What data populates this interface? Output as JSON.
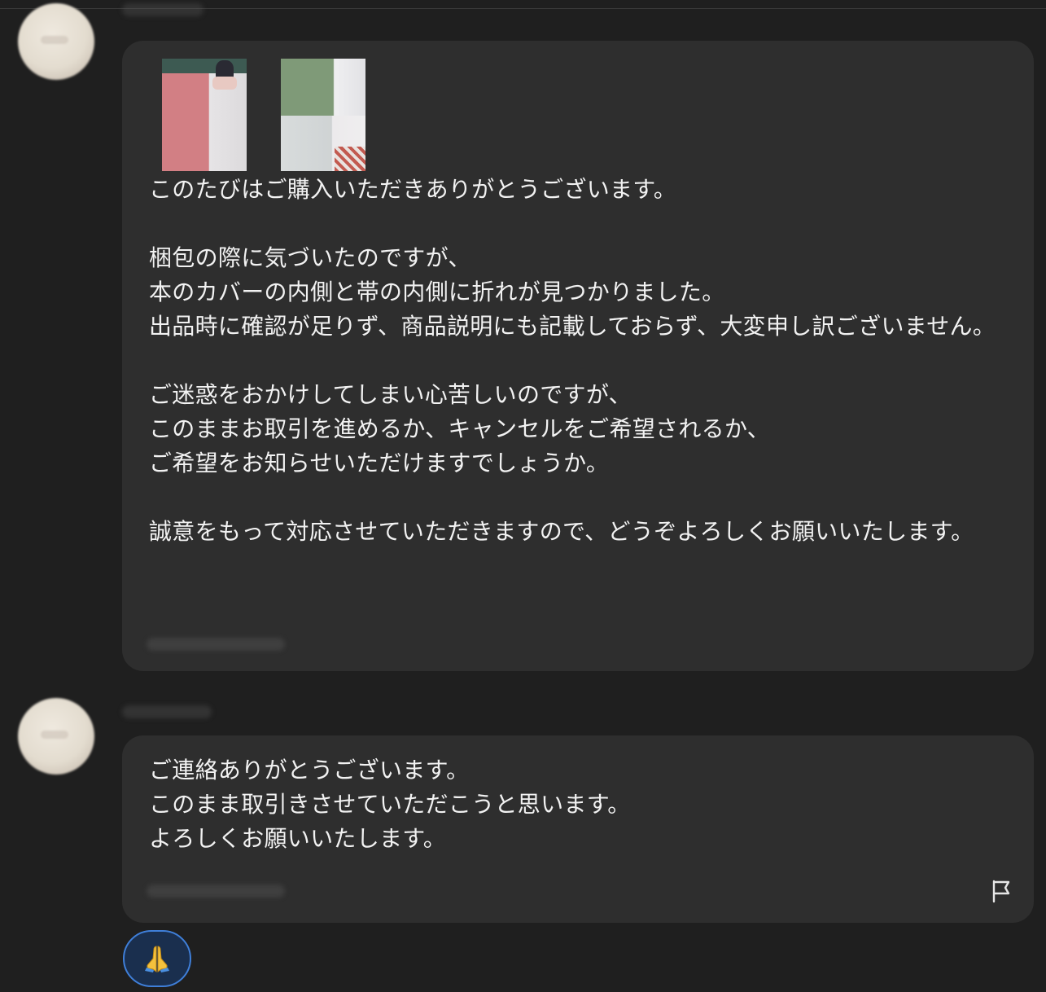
{
  "messages": [
    {
      "sender": "seller",
      "attachments": [
        {
          "icon": "book-cover-photo"
        },
        {
          "icon": "book-inner-photo"
        }
      ],
      "text": "このたびはご購入いただきありがとうございます。\n\n梱包の際に気づいたのですが、\n本のカバーの内側と帯の内側に折れが見つかりました。\n出品時に確認が足りず、商品説明にも記載しておらず、大変申し訳ございません。\n\nご迷惑をおかけしてしまい心苦しいのですが、\nこのままお取引を進めるか、キャンセルをご希望されるか、\nご希望をお知らせいただけますでしょうか。\n\n誠意をもって対応させていただきますので、どうぞよろしくお願いいたします。"
    },
    {
      "sender": "buyer",
      "text": "ご連絡ありがとうございます。\nこのまま取引きさせていただこうと思います。\nよろしくお願いいたします。",
      "reaction": {
        "emoji": "🙏",
        "icon": "folded-hands-icon"
      }
    }
  ],
  "colors": {
    "background": "#1f1f1f",
    "bubble": "#2e2e2e",
    "reaction_border": "#3f7fd9",
    "reaction_fill": "#1a2f4e"
  }
}
